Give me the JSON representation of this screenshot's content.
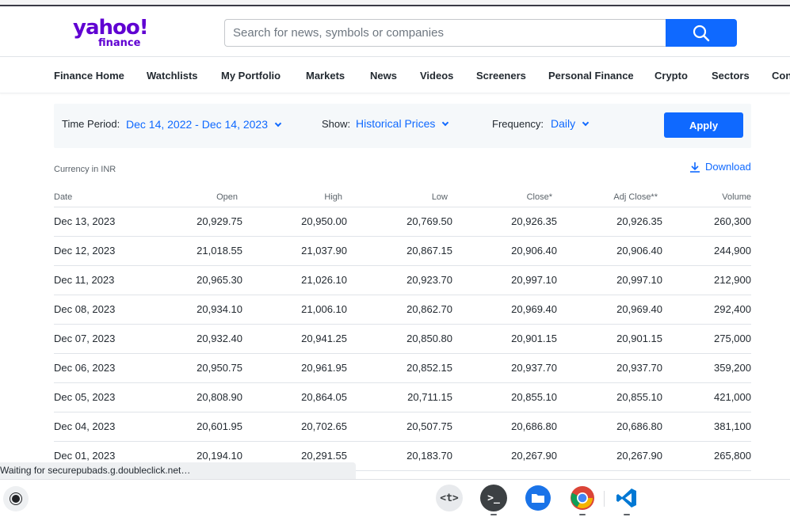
{
  "header": {
    "logo_text": "yahoo!",
    "logo_sub": "finance",
    "search_placeholder": "Search for news, symbols or companies"
  },
  "nav": {
    "items": [
      "Finance Home",
      "Watchlists",
      "My Portfolio",
      "Markets",
      "News",
      "Videos",
      "Screeners",
      "Personal Finance",
      "Crypto",
      "Sectors",
      "Con"
    ]
  },
  "filters": {
    "time_period_label": "Time Period:",
    "time_period_value": "Dec 14, 2022 - Dec 14, 2023",
    "show_label": "Show:",
    "show_value": "Historical Prices",
    "frequency_label": "Frequency:",
    "frequency_value": "Daily",
    "apply_label": "Apply"
  },
  "currency_note": "Currency in INR",
  "download_label": "Download",
  "table": {
    "headers": [
      "Date",
      "Open",
      "High",
      "Low",
      "Close*",
      "Adj Close**",
      "Volume"
    ],
    "rows": [
      [
        "Dec 13, 2023",
        "20,929.75",
        "20,950.00",
        "20,769.50",
        "20,926.35",
        "20,926.35",
        "260,300"
      ],
      [
        "Dec 12, 2023",
        "21,018.55",
        "21,037.90",
        "20,867.15",
        "20,906.40",
        "20,906.40",
        "244,900"
      ],
      [
        "Dec 11, 2023",
        "20,965.30",
        "21,026.10",
        "20,923.70",
        "20,997.10",
        "20,997.10",
        "212,900"
      ],
      [
        "Dec 08, 2023",
        "20,934.10",
        "21,006.10",
        "20,862.70",
        "20,969.40",
        "20,969.40",
        "292,400"
      ],
      [
        "Dec 07, 2023",
        "20,932.40",
        "20,941.25",
        "20,850.80",
        "20,901.15",
        "20,901.15",
        "275,000"
      ],
      [
        "Dec 06, 2023",
        "20,950.75",
        "20,961.95",
        "20,852.15",
        "20,937.70",
        "20,937.70",
        "359,200"
      ],
      [
        "Dec 05, 2023",
        "20,808.90",
        "20,864.05",
        "20,711.15",
        "20,855.10",
        "20,855.10",
        "421,000"
      ],
      [
        "Dec 04, 2023",
        "20,601.95",
        "20,702.65",
        "20,507.75",
        "20,686.80",
        "20,686.80",
        "381,100"
      ],
      [
        "Dec 01, 2023",
        "20,194.10",
        "20,291.55",
        "20,183.70",
        "20,267.90",
        "20,267.90",
        "265,800"
      ]
    ]
  },
  "status_text": "Waiting for securepubads.g.doubleclick.net…",
  "taskbar": {
    "apps": [
      "text-editor-icon",
      "terminal-icon",
      "files-icon",
      "chrome-icon",
      "vscode-icon"
    ],
    "terminal_glyph": ">_",
    "editor_glyph": "<t>"
  },
  "colors": {
    "brand": "#6001d2",
    "accent": "#0f69ff"
  }
}
